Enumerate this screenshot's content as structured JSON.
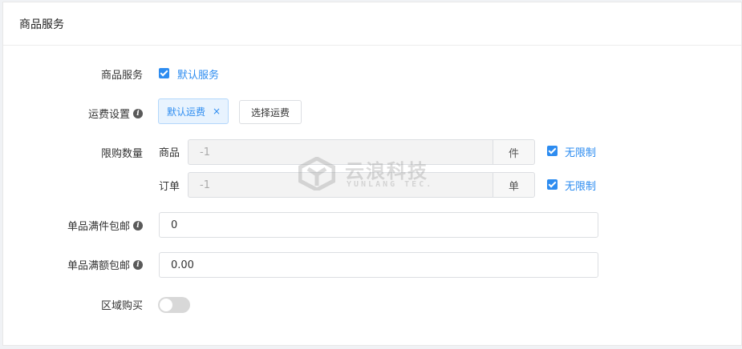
{
  "card": {
    "title": "商品服务"
  },
  "service": {
    "label": "商品服务",
    "checkbox_label": "默认服务",
    "checked": true
  },
  "shipping": {
    "label": "运费设置",
    "tag_label": "默认运费",
    "tag_close": "×",
    "select_button": "选择运费"
  },
  "limit": {
    "label": "限购数量",
    "product": {
      "sub_label": "商品",
      "value": "-1",
      "unit": "件",
      "unlimited_label": "无限制",
      "checked": true
    },
    "order": {
      "sub_label": "订单",
      "value": "-1",
      "unit": "单",
      "unlimited_label": "无限制",
      "checked": true
    }
  },
  "free_by_count": {
    "label": "单品满件包邮",
    "value": "0"
  },
  "free_by_amount": {
    "label": "单品满额包邮",
    "value": "0.00"
  },
  "region": {
    "label": "区域购买",
    "enabled": false
  },
  "watermark": {
    "title": "云浪科技",
    "subtitle": "YUNLANG TEC."
  },
  "colors": {
    "accent": "#2d8cf0",
    "tag_bg": "#e8f3fe",
    "border": "#dcdee2"
  }
}
